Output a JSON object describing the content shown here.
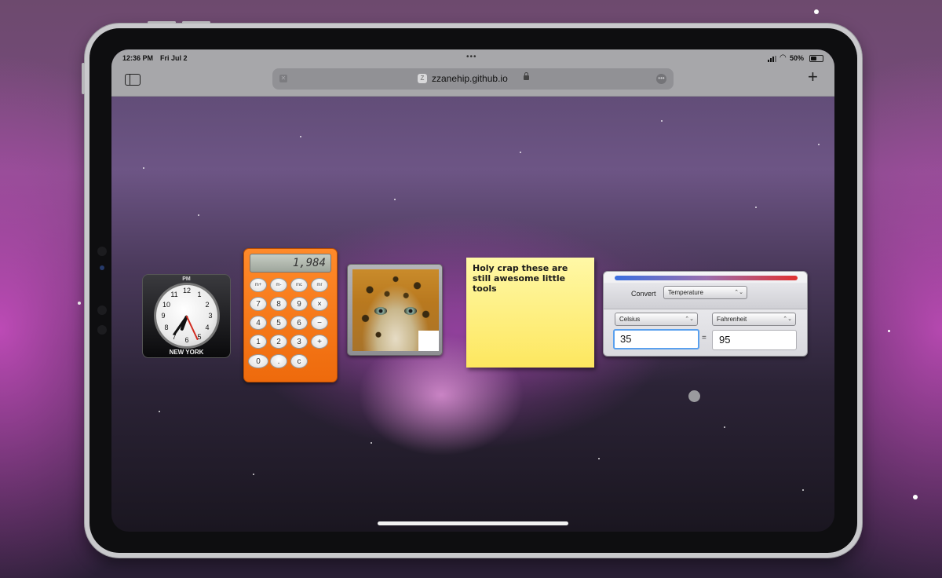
{
  "status_bar": {
    "time": "12:36 PM",
    "date": "Fri Jul 2",
    "battery": "50%",
    "battery_level": 0.5
  },
  "browser": {
    "url": "zzanehip.github.io",
    "url_favicon": "Z",
    "plus_label": "+",
    "icons": [
      "sidebar-icon",
      "close-icon",
      "lock-icon",
      "more-icon",
      "plus-icon",
      "wifi-icon",
      "signal-icon",
      "battery-icon"
    ]
  },
  "clock_widget": {
    "period": "PM",
    "city": "NEW YORK",
    "numbers": [
      "12",
      "1",
      "2",
      "3",
      "4",
      "5",
      "6",
      "7",
      "8",
      "9",
      "10",
      "11"
    ]
  },
  "calculator_widget": {
    "display": "1,984",
    "memory_keys": [
      "m+",
      "m-",
      "mc",
      "mr"
    ],
    "keys": [
      "7",
      "8",
      "9",
      "4",
      "5",
      "6",
      "1",
      "2",
      "3",
      "0",
      ".",
      "c"
    ],
    "operator_keys": [
      "÷",
      "×",
      "−",
      "+",
      "="
    ]
  },
  "sticky_note": {
    "text": "Holy crap these are still awesome little tools"
  },
  "converter_widget": {
    "convert_label": "Convert",
    "category": "Temperature",
    "from_unit": "Celsius",
    "to_unit": "Fahrenheit",
    "from_value": "35",
    "to_value": "95",
    "equals": "="
  },
  "colors": {
    "calculator_orange": "#f07413",
    "sticky_yellow": "#fdea6a",
    "toolbar_gray": "#a7a7aa"
  }
}
